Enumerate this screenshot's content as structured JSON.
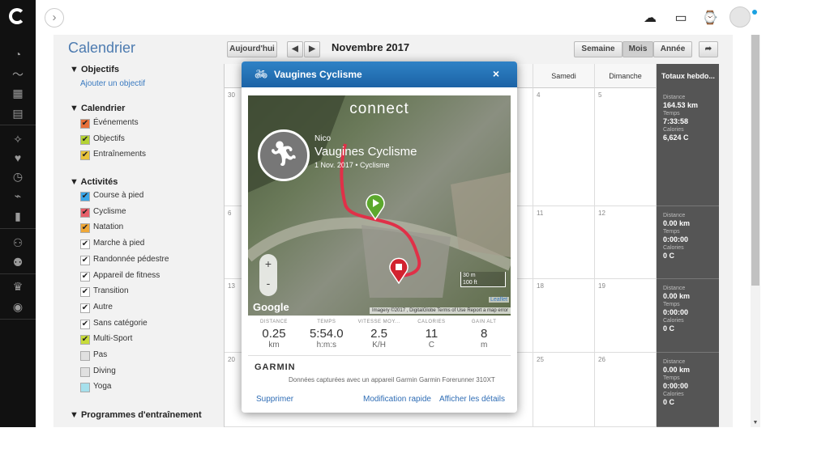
{
  "topbar": {
    "expand_icon": "›"
  },
  "sidebar": {
    "title": "Calendrier",
    "objectives_heading": "▼ Objectifs",
    "add_objective": "Ajouter un objectif",
    "calendar_heading": "▼ Calendrier",
    "calendar_items": [
      {
        "label": "Événements",
        "color": "#e8703a"
      },
      {
        "label": "Objectifs",
        "color": "#b5d334"
      },
      {
        "label": "Entraînements",
        "color": "#e8c33a"
      }
    ],
    "activities_heading": "▼ Activités",
    "activity_items": [
      {
        "label": "Course à pied",
        "color": "#3aa6e8"
      },
      {
        "label": "Cyclisme",
        "color": "#e8606a"
      },
      {
        "label": "Natation",
        "color": "#f0a838"
      },
      {
        "label": "Marche à pied",
        "color": "#ffffff"
      },
      {
        "label": "Randonnée pédestre",
        "color": "#ffffff"
      },
      {
        "label": "Appareil de fitness",
        "color": "#ffffff"
      },
      {
        "label": "Transition",
        "color": "#ffffff"
      },
      {
        "label": "Autre",
        "color": "#ffffff"
      },
      {
        "label": "Sans catégorie",
        "color": "#ffffff"
      },
      {
        "label": "Multi-Sport",
        "color": "#c8dc3a"
      },
      {
        "label": "Pas",
        "color": "#e0e0e0"
      },
      {
        "label": "Diving",
        "color": "#e0e0e0"
      },
      {
        "label": "Yoga",
        "color": "#a6e0ec"
      }
    ],
    "programs_heading": "▼ Programmes d'entraînement"
  },
  "toolbar": {
    "today": "Aujourd'hui",
    "prev": "◀",
    "next": "▶",
    "month": "Novembre 2017",
    "week": "Semaine",
    "month_view": "Mois",
    "year": "Année",
    "share": "➦"
  },
  "grid": {
    "headers": [
      "Samedi",
      "Dimanche"
    ],
    "totals_header": "Totaux hebdo...",
    "rows": [
      {
        "days": [
          "30",
          "4",
          "5"
        ],
        "distance": "164.53 km",
        "time": "7:33:58",
        "calories": "6,624 C"
      },
      {
        "days": [
          "6",
          "11",
          "12"
        ],
        "distance": "0.00 km",
        "time": "0:00:00",
        "calories": "0 C"
      },
      {
        "days": [
          "13",
          "18",
          "19"
        ],
        "distance": "0.00 km",
        "time": "0:00:00",
        "calories": "0 C"
      },
      {
        "days": [
          "20",
          "25",
          "26"
        ],
        "distance": "0.00 km",
        "time": "0:00:00",
        "calories": "0 C"
      }
    ],
    "labels": {
      "distance": "Distance",
      "time": "Temps",
      "calories": "Calories"
    }
  },
  "modal": {
    "title": "Vaugines Cyclisme",
    "close": "×",
    "connect": "connect",
    "user": "Nico",
    "activity": "Vaugines Cyclisme",
    "date": "1 Nov. 2017 • Cyclisme",
    "zoom_in": "+",
    "zoom_out": "-",
    "scale_m": "30 m",
    "scale_ft": "100 ft",
    "leaflet": "Leaflet",
    "google": "Google",
    "attribution": "Imagery ©2017 , DigitalGlobe   Terms of Use   Report a map error",
    "stats": [
      {
        "label": "DISTANCE",
        "value": "0.25",
        "unit": "km"
      },
      {
        "label": "TEMPS",
        "value": "5:54.0",
        "unit": "h:m:s"
      },
      {
        "label": "VITESSE MOY...",
        "value": "2.5",
        "unit": "K/H"
      },
      {
        "label": "CALORIES",
        "value": "11",
        "unit": "C"
      },
      {
        "label": "GAIN ALT",
        "value": "8",
        "unit": "m"
      }
    ],
    "garmin": "GARMIN",
    "capture": "Données capturées avec un appareil Garmin Garmin Forerunner 310XT",
    "delete": "Supprimer",
    "quick_edit": "Modification rapide",
    "details": "Afficher les détails"
  }
}
